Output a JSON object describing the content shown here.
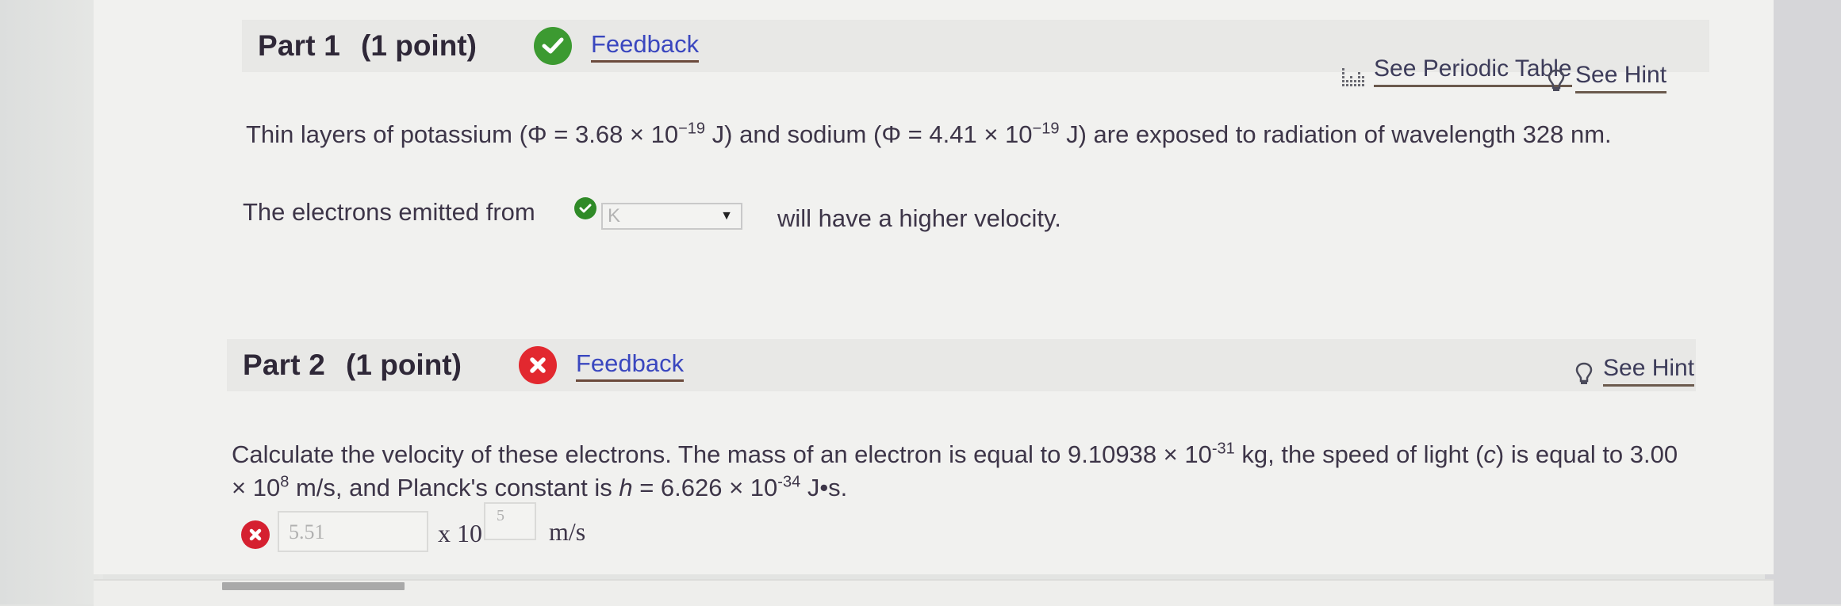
{
  "part1": {
    "title": "Part 1",
    "points": "(1 point)",
    "status": "correct",
    "feedback_label": "Feedback",
    "periodic_table_label": "See Periodic Table",
    "hint_label": "See Hint",
    "question": {
      "pre_k": "Thin layers of potassium (Φ = 3.68 × 10",
      "k_exp": "−19",
      "mid": " J) and sodium (Φ = 4.41 × 10",
      "na_exp": "−19",
      "post": " J) are exposed to radiation of wavelength 328 nm."
    },
    "sentence": {
      "before": "The electrons emitted from",
      "after": "will have a higher velocity."
    },
    "dropdown": {
      "selected": "K",
      "status": "correct"
    }
  },
  "part2": {
    "title": "Part 2",
    "points": "(1 point)",
    "status": "incorrect",
    "feedback_label": "Feedback",
    "hint_label": "See Hint",
    "question": {
      "line1_a": "Calculate the velocity of these electrons. The mass of an electron is equal to 9.10938 × 10",
      "line1_exp": "-31",
      "line1_b": " kg, the speed of light (",
      "line1_c_var": "c",
      "line1_c": ") is equal to 3.00",
      "line2_a": "× 10",
      "line2_exp": "8",
      "line2_b": " m/s, and Planck's constant is ",
      "line2_h": "h",
      "line2_c": " = 6.626 × 10",
      "line2_exp2": "-34",
      "line2_d": " J•s."
    },
    "answer": {
      "mantissa": "5.51",
      "times_ten": "x 10",
      "exponent": "5",
      "unit": "m/s",
      "status": "incorrect"
    }
  },
  "colors": {
    "correct": "#3c9a31",
    "incorrect": "#e2282f",
    "link": "#3a47bf"
  }
}
